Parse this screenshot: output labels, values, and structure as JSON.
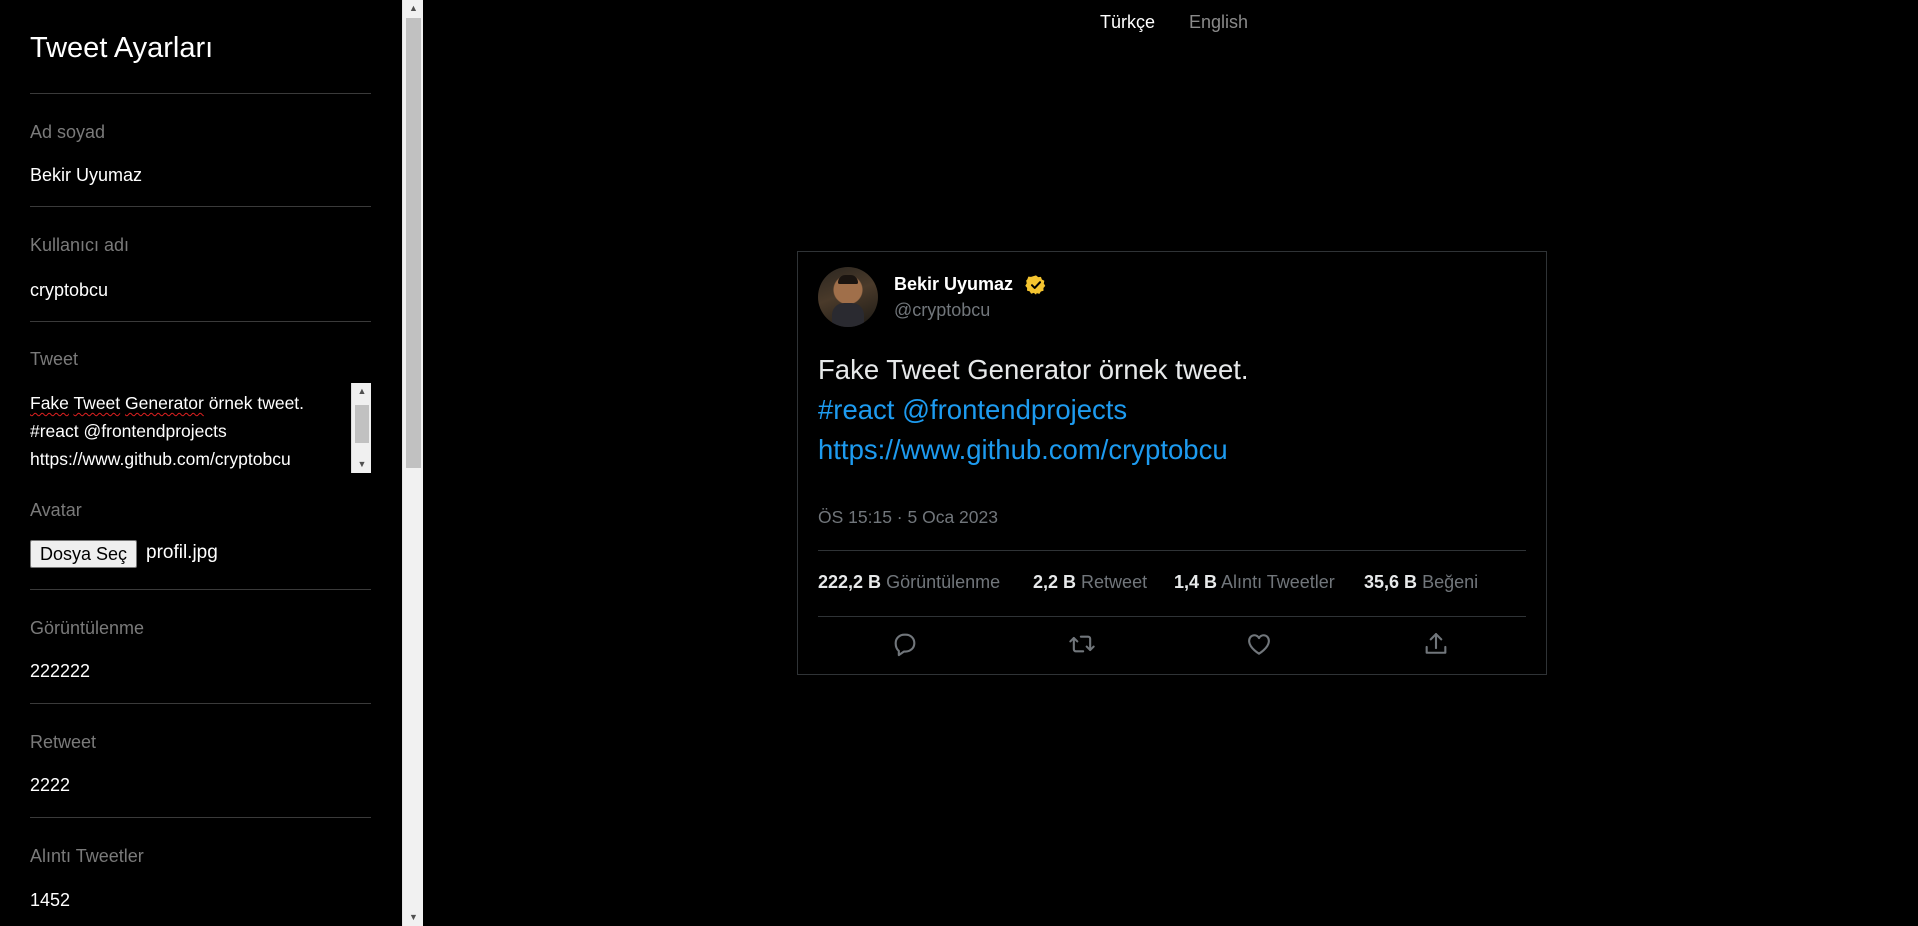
{
  "sidebar": {
    "title": "Tweet Ayarları",
    "name": {
      "label": "Ad soyad",
      "value": "Bekir Uyumaz"
    },
    "username": {
      "label": "Kullanıcı adı",
      "value": "cryptobcu"
    },
    "tweet": {
      "label": "Tweet",
      "line1_word1": "Fake",
      "line1_word2": "Tweet",
      "line1_word3": "Generator",
      "line1_rest": "örnek tweet.",
      "line2": "#react @frontendprojects",
      "line3": "https://www.github.com/cryptobcu"
    },
    "avatar": {
      "label": "Avatar",
      "button_label": "Dosya Seç",
      "file_name": "profil.jpg"
    },
    "views": {
      "label": "Görüntülenme",
      "value": "222222"
    },
    "retweets": {
      "label": "Retweet",
      "value": "2222"
    },
    "quotes": {
      "label": "Alıntı Tweetler",
      "value": "1452"
    }
  },
  "language": {
    "active": "Türkçe",
    "inactive": "English"
  },
  "tweet_card": {
    "name": "Bekir Uyumaz",
    "handle": "@cryptobcu",
    "text_line1": "Fake Tweet Generator örnek tweet.",
    "text_line2": "#react @frontendprojects",
    "text_line3": "https://www.github.com/cryptobcu",
    "time": "ÖS 15:15 · 5 Oca 2023",
    "stats": {
      "views_num": "222,2 B",
      "views_label": "Görüntülenme",
      "retweets_num": "2,2 B",
      "retweets_label": "Retweet",
      "quotes_num": "1,4 B",
      "quotes_label": "Alıntı Tweetler",
      "likes_num": "35,6 B",
      "likes_label": "Beğeni"
    },
    "icons": [
      "reply-icon",
      "retweet-icon",
      "like-icon",
      "share-icon"
    ]
  },
  "colors": {
    "background": "#000000",
    "link": "#1d9bf0",
    "muted": "#71767b",
    "verified": "#f4c430"
  }
}
